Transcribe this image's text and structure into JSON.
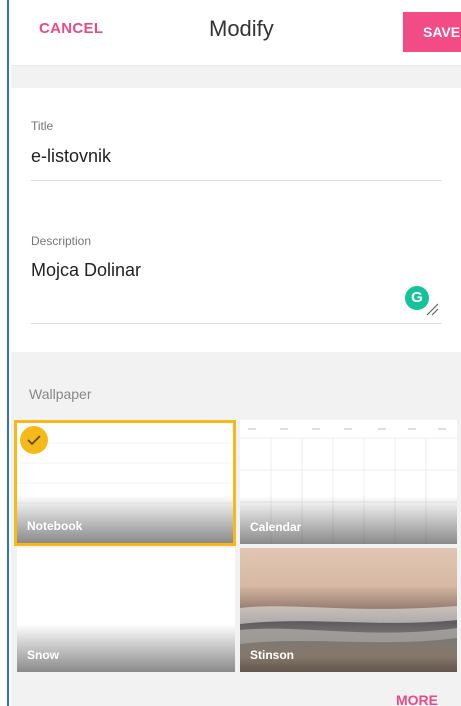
{
  "topbar": {
    "cancel_label": "CANCEL",
    "title": "Modify",
    "save_label": "SAVE"
  },
  "form": {
    "title_label": "Title",
    "title_value": "e-listovnik",
    "description_label": "Description",
    "description_value": "Mojca Dolinar"
  },
  "grammarly": {
    "icon": "grammarly-icon",
    "glyph": "G"
  },
  "wallpaper": {
    "section_label": "Wallpaper",
    "tiles": [
      {
        "label": "Notebook",
        "selected": true
      },
      {
        "label": "Calendar",
        "selected": false
      },
      {
        "label": "Snow",
        "selected": false
      },
      {
        "label": "Stinson",
        "selected": false
      }
    ],
    "more_label": "MORE"
  },
  "colors": {
    "accent": "#e84b8a",
    "save_background": "#f24b86",
    "selection": "#f6b91a",
    "grammarly": "#15c39a"
  }
}
